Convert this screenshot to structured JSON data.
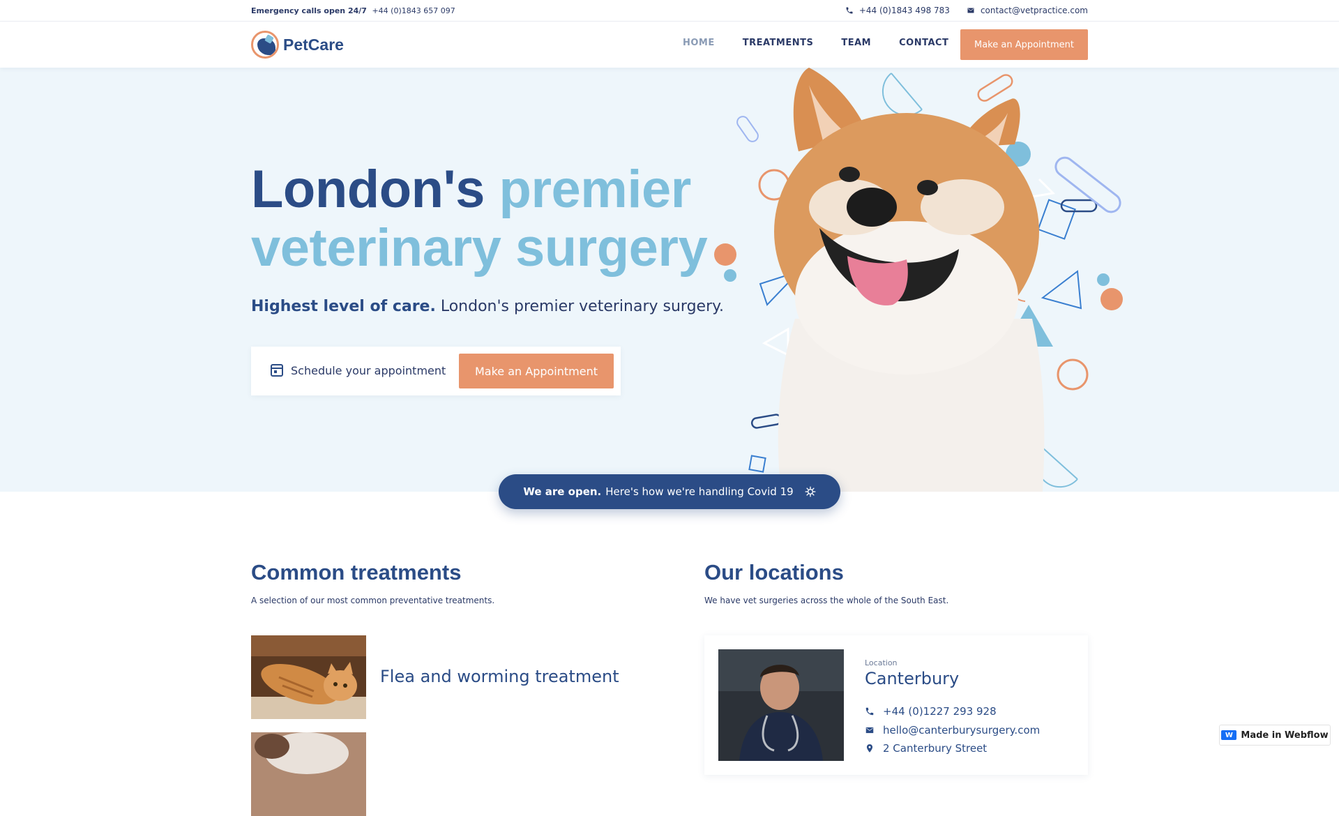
{
  "topbar": {
    "emergency_label": "Emergency calls open 24/7",
    "emergency_phone": "+44 (0)1843 657 097",
    "phone": "+44 (0)1843 498 783",
    "email": "contact@vetpractice.com"
  },
  "navbar": {
    "logo_text": "PetCare",
    "links": [
      "HOME",
      "TREATMENTS",
      "TEAM",
      "CONTACT"
    ],
    "active_link": "HOME",
    "cta_label": "Make an Appointment"
  },
  "hero": {
    "title_dark": "London's",
    "title_light_1": "premier",
    "title_light_2": "veterinary surgery",
    "subtitle_bold": "Highest level of care.",
    "subtitle_rest": "London's premier veterinary surgery.",
    "schedule_label": "Schedule your appointment",
    "schedule_button": "Make an Appointment"
  },
  "covid_banner": {
    "bold": "We are open.",
    "text": "Here's how we're handling Covid 19"
  },
  "treatments": {
    "title": "Common treatments",
    "subtitle": "A selection of our most common preventative treatments.",
    "items": [
      "Flea and worming treatment"
    ]
  },
  "locations": {
    "title": "Our locations",
    "subtitle": "We have vet surgeries across the whole of the South East.",
    "card": {
      "label": "Location",
      "name": "Canterbury",
      "phone": "+44 (0)1227 293 928",
      "email": "hello@canterburysurgery.com",
      "address": "2 Canterbury Street"
    }
  },
  "badge": {
    "label": "Made in Webflow"
  },
  "colors": {
    "primary": "#2b4c86",
    "accent_light": "#7fbfdc",
    "accent_orange": "#e8956c",
    "hero_bg": "#eef6fb"
  }
}
